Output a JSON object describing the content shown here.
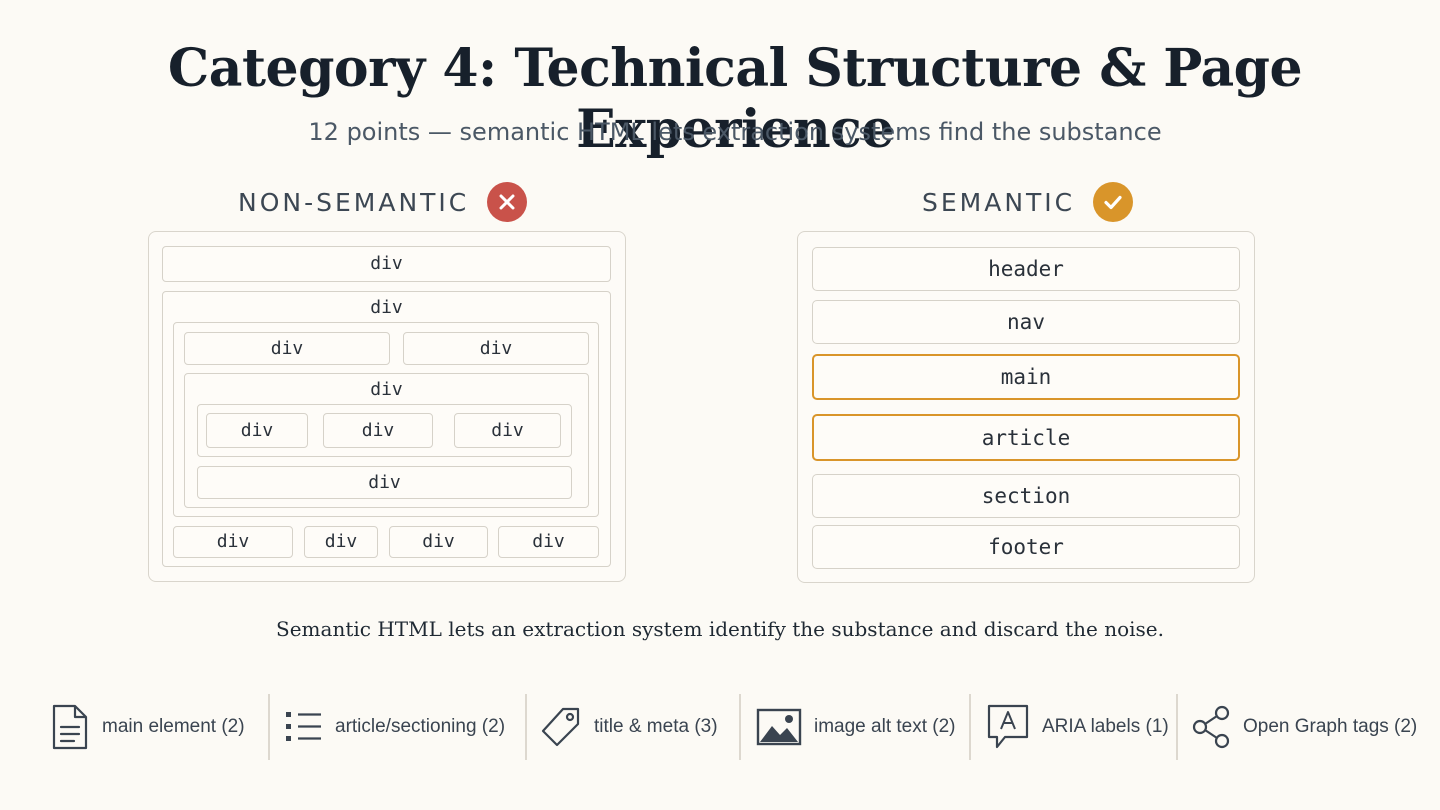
{
  "title": "Category 4: Technical Structure & Page Experience",
  "subtitle": "12 points — semantic HTML lets extraction systems find the substance",
  "non_semantic": {
    "heading": "NON-SEMANTIC",
    "status_icon": "x-circle-icon",
    "status_color": "#c9524a",
    "tag": "div"
  },
  "semantic": {
    "heading": "SEMANTIC",
    "status_icon": "check-circle-icon",
    "status_color": "#d9952a",
    "highlight_color": "#d9952a",
    "elements": [
      {
        "label": "header",
        "highlighted": false
      },
      {
        "label": "nav",
        "highlighted": false
      },
      {
        "label": "main",
        "highlighted": true
      },
      {
        "label": "article",
        "highlighted": true
      },
      {
        "label": "section",
        "highlighted": false
      },
      {
        "label": "footer",
        "highlighted": false
      }
    ]
  },
  "caption": "Semantic HTML lets an extraction system identify the substance and discard the noise.",
  "legend": [
    {
      "icon": "document-icon",
      "label": "main element (2)"
    },
    {
      "icon": "list-icon",
      "label": "article/sectioning (2)"
    },
    {
      "icon": "tag-icon",
      "label": "title & meta (3)"
    },
    {
      "icon": "image-icon",
      "label": "image alt text (2)"
    },
    {
      "icon": "speech-bubble-icon",
      "label": "ARIA labels (1)"
    },
    {
      "icon": "share-icon",
      "label": "Open Graph tags (2)"
    }
  ]
}
